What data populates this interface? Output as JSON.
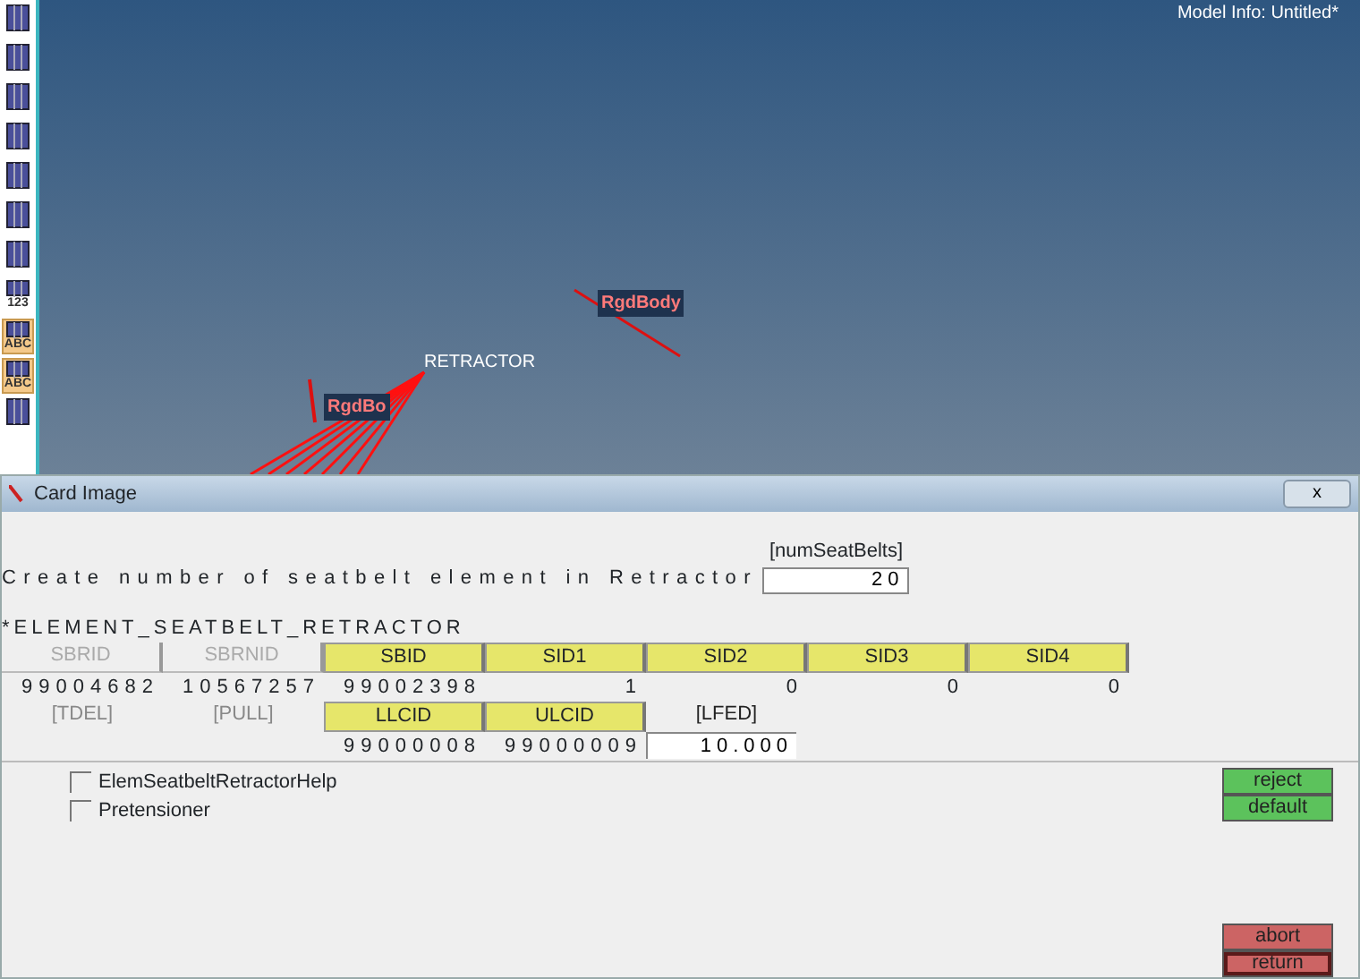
{
  "viewport": {
    "model_info": "Model Info: Untitled*",
    "labels": [
      {
        "text": "RETRACTOR",
        "kind": "node"
      },
      {
        "text": "RgdBody",
        "kind": "body"
      },
      {
        "text": "RgdBo",
        "kind": "body"
      }
    ]
  },
  "toolbar": [
    {
      "kind": "plain"
    },
    {
      "kind": "plain"
    },
    {
      "kind": "plain"
    },
    {
      "kind": "plain"
    },
    {
      "kind": "plain"
    },
    {
      "kind": "plain"
    },
    {
      "kind": "plain"
    },
    {
      "kind": "labeled",
      "label": "123"
    },
    {
      "kind": "highlighted",
      "label": "ABC"
    },
    {
      "kind": "highlighted",
      "label": "ABC"
    },
    {
      "kind": "plain"
    }
  ],
  "dialog": {
    "title": "Card Image",
    "close": "x",
    "prompt": {
      "text": "Create number of seatbelt element in Retractor",
      "label": "[numSeatBelts]",
      "value": "20"
    },
    "card_name": "*ELEMENT_SEATBELT_RETRACTOR",
    "rows": [
      [
        {
          "label": "SBRID",
          "kind": "inactive",
          "value": "99004682"
        },
        {
          "label": "SBRNID",
          "kind": "inactive",
          "value": "10567257"
        },
        {
          "label": "SBID",
          "kind": "active",
          "value": "99002398"
        },
        {
          "label": "SID1",
          "kind": "active",
          "value": "1"
        },
        {
          "label": "SID2",
          "kind": "active",
          "value": "0"
        },
        {
          "label": "SID3",
          "kind": "active",
          "value": "0"
        },
        {
          "label": "SID4",
          "kind": "active",
          "value": "0"
        }
      ],
      [
        {
          "label": "[TDEL]",
          "kind": "optional"
        },
        {
          "label": "[PULL]",
          "kind": "optional"
        },
        {
          "label": "LLCID",
          "kind": "active",
          "value": "99000008"
        },
        {
          "label": "ULCID",
          "kind": "active",
          "value": "99000009"
        },
        {
          "label": "[LFED]",
          "kind": "input",
          "value": "10.000"
        }
      ]
    ],
    "options": [
      {
        "label": "ElemSeatbeltRetractorHelp",
        "checked": false
      },
      {
        "label": "Pretensioner",
        "checked": false
      }
    ],
    "buttons": [
      {
        "label": "reject",
        "kind": "green"
      },
      {
        "label": "default",
        "kind": "green"
      },
      {
        "label": "abort",
        "kind": "red"
      },
      {
        "label": "return",
        "kind": "red-outlined"
      }
    ]
  }
}
